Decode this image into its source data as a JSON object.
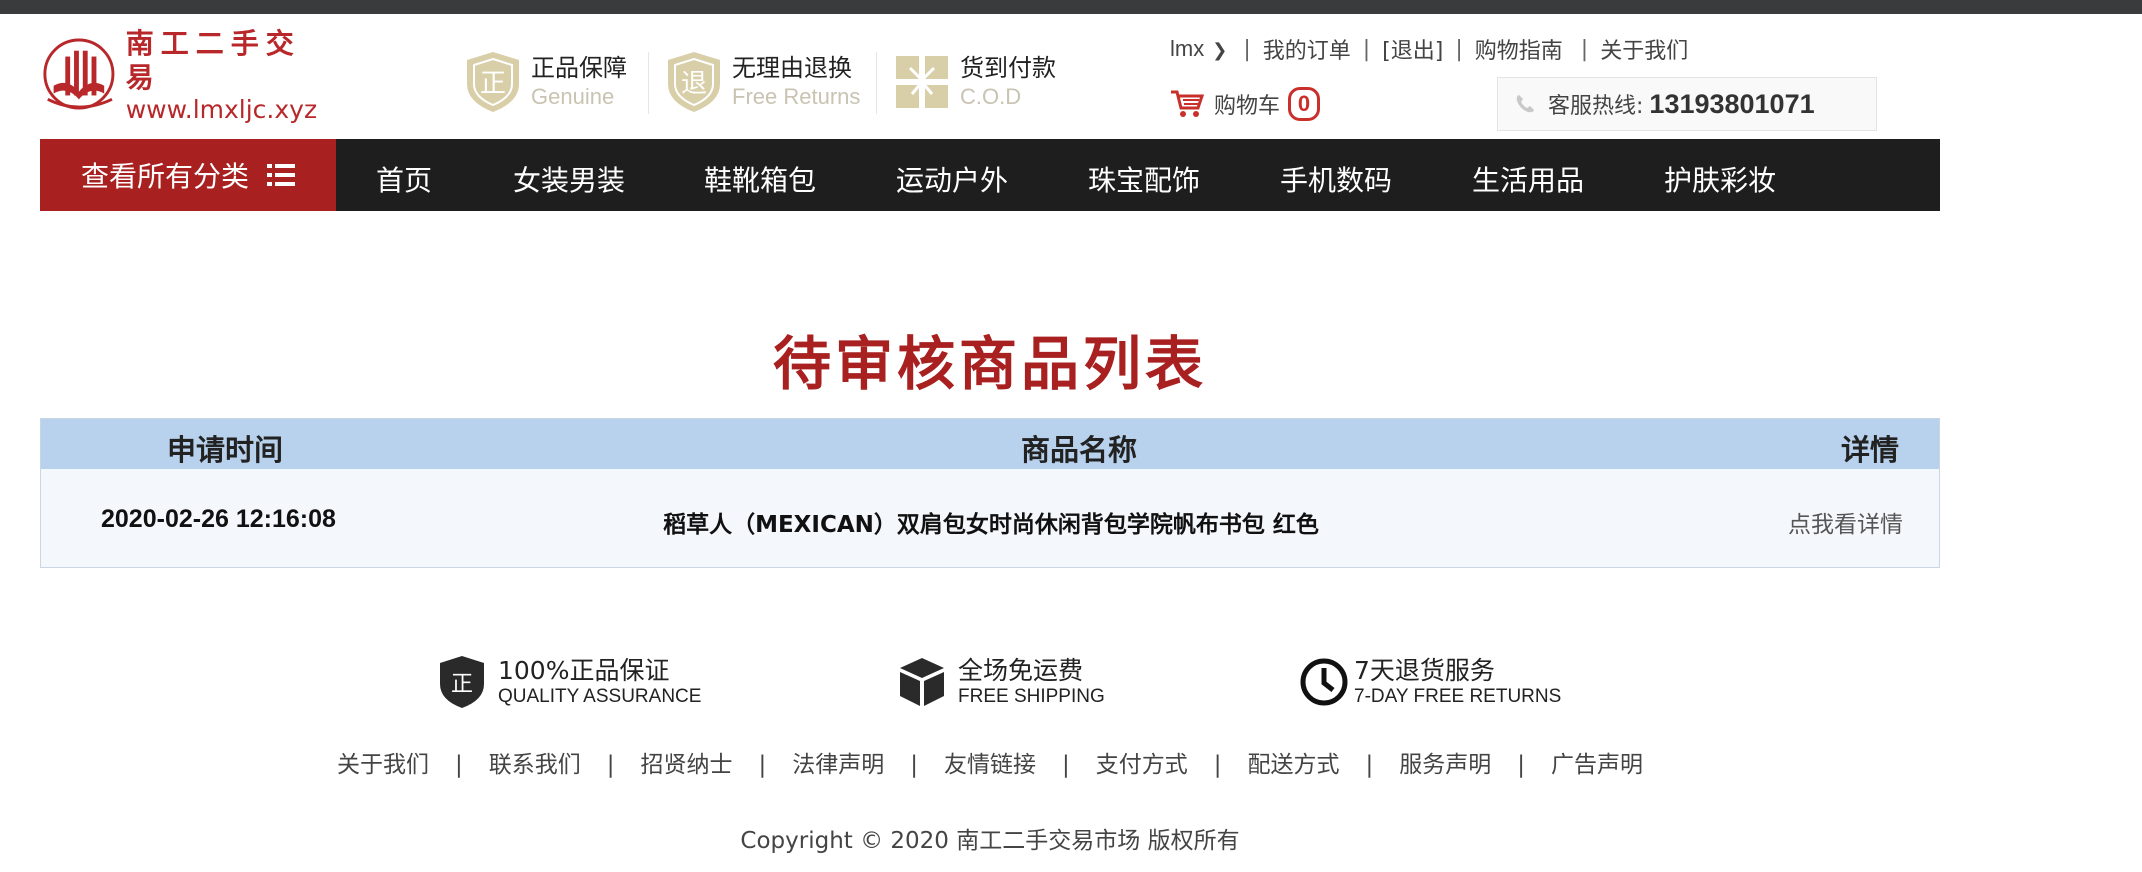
{
  "logo": {
    "name": "南工二手交易",
    "url": "www.lmxljc.xyz"
  },
  "promises": [
    {
      "cn": "正品保障",
      "en": "Genuine",
      "badge": "正"
    },
    {
      "cn": "无理由退换",
      "en": "Free Returns",
      "badge": "退"
    },
    {
      "cn": "货到付款",
      "en": "C.O.D"
    }
  ],
  "top_links": {
    "user": "lmx",
    "orders": "我的订单",
    "logout": "[退出]",
    "guide": "购物指南",
    "about": "关于我们",
    "separator": "|"
  },
  "cart": {
    "label": "购物车",
    "count": "0"
  },
  "hotline": {
    "label": "客服热线:",
    "number": "13193801071"
  },
  "nav": {
    "all_categories": "查看所有分类",
    "items": [
      "首页",
      "女装男装",
      "鞋靴箱包",
      "运动户外",
      "珠宝配饰",
      "手机数码",
      "生活用品",
      "护肤彩妆"
    ]
  },
  "main": {
    "title": "待审核商品列表",
    "table": {
      "headers": {
        "time": "申请时间",
        "name": "商品名称",
        "detail": "详情"
      },
      "rows": [
        {
          "time": "2020-02-26 12:16:08",
          "name": "稻草人（MEXICAN）双肩包女时尚休闲背包学院帆布书包 红色",
          "detail": "点我看详情"
        }
      ]
    }
  },
  "services": [
    {
      "cn": "100%正品保证",
      "en": "QUALITY ASSURANCE",
      "badge": "正"
    },
    {
      "cn": "全场免运费",
      "en": "FREE SHIPPING"
    },
    {
      "cn": "7天退货服务",
      "en": "7-DAY FREE RETURNS"
    }
  ],
  "footer": {
    "links": [
      "关于我们",
      "联系我们",
      "招贤纳士",
      "法律声明",
      "友情链接",
      "支付方式",
      "配送方式",
      "服务声明",
      "广告声明"
    ],
    "separator": "|",
    "copyright": "Copyright © 2020 南工二手交易市场 版权所有"
  },
  "colors": {
    "brand_red": "#a8201f",
    "nav_bg": "#1e1e1e",
    "table_header_bg": "#b8d1ec",
    "row_bg": "#f4f8fd",
    "badge_gold": "#d8cfa9"
  }
}
